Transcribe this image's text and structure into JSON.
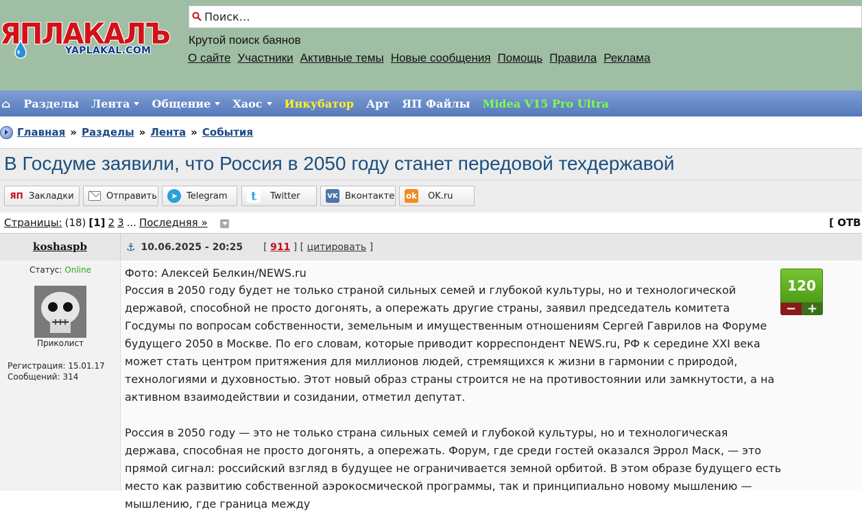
{
  "logo": {
    "main": "ЯПЛАКАЛЪ",
    "sub": "YAPLAKAL.COM"
  },
  "search": {
    "placeholder": "Поиск…"
  },
  "tagline": "Крутой поиск баянов",
  "toplinks": [
    "О сайте",
    "Участники",
    "Активные темы",
    "Новые сообщения",
    "Помощь",
    "Правила",
    "Реклама"
  ],
  "nav": {
    "home": "⌂",
    "items": [
      "Разделы",
      "Лента",
      "Общение",
      "Хаос",
      "Инкубатор",
      "Арт",
      "ЯП Файлы",
      "Midea V15 Pro Ultra"
    ]
  },
  "breadcrumbs": [
    "Главная",
    "Разделы",
    "Лента",
    "События"
  ],
  "breadcrumb_sep": "»",
  "title": "В Госдуме заявили, что Россия в 2050 году станет передовой техдержавой",
  "share": {
    "bookmarks": "Закладки",
    "bookmarks_icon": "ЯП",
    "send": "Отправить",
    "telegram": "Telegram",
    "twitter": "Twitter",
    "vk": "Вконтакте",
    "ok": "OK.ru"
  },
  "pages": {
    "label": "Страницы:",
    "count": "(18)",
    "current": "[1]",
    "p2": "2",
    "p3": "3",
    "dots": "...",
    "last": "Последняя »",
    "right": "[ ОТВ"
  },
  "post": {
    "author": "koshaspb",
    "anchor": "⚓",
    "date": "10.06.2025 - 20:25",
    "num_open": "[",
    "num": "911",
    "num_sep": "] [",
    "quote": "цитировать",
    "quote_close": "]",
    "status_label": "Статус:",
    "status_value": "Online",
    "rank": "Приколист",
    "reg": "Регистрация: 15.01.17",
    "messages": "Сообщений: 314",
    "rating": "120",
    "rate_minus": "−",
    "rate_plus": "+",
    "photo": "Фото: Алексей Белкин/NEWS.ru",
    "p1": "Россия в 2050 году будет не только страной сильных семей и глубокой культуры, но и технологической державой, способной не просто догонять, а опережать другие страны, заявил председатель комитета Госдумы по вопросам собственности, земельным и имущественным отношениям Сергей Гаврилов на Форуме будущего 2050 в Москве. По его словам, которые приводит корреспондент NEWS.ru, РФ к середине XXI века может стать центром притяжения для миллионов людей, стремящихся к жизни в гармонии с природой, технологиями и духовностью. Этот новый образ страны строится не на противостоянии или замкнутости, а на активном взаимодействии и созидании, отметил депутат.",
    "p2": "Россия в 2050 году — это не только страна сильных семей и глубокой культуры, но и технологическая держава, способная не просто догонять, а опережать. Форум, где среди гостей оказался Эррол Маск, — это прямой сигнал: российский взгляд в будущее не ограничивается земной орбитой. В этом образе будущего есть место как развитию собственной аэрокосмической программы, так и принципиально новому мышлению — мышлению, где граница между"
  },
  "colors": {
    "header_bg": "#9fbea3",
    "nav_bg": "#5579bb",
    "title_color": "#1b4f7d",
    "link_blue": "#1b4a84",
    "accent_red": "#c0101a",
    "online_green": "#2ea51e",
    "rating_green": "#5aa91e"
  }
}
